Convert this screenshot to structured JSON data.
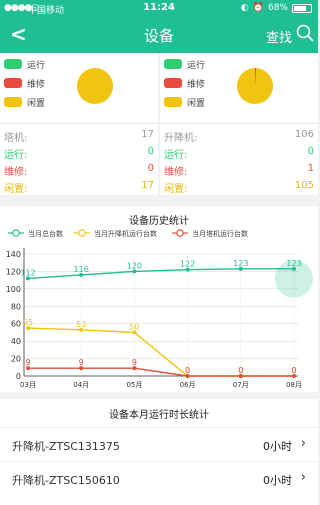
{
  "status": {
    "carrier": "中国移动",
    "time": "11:24",
    "battery": "68%"
  },
  "nav": {
    "title": "设备",
    "find_label": "查找"
  },
  "legend": [
    "运行",
    "维修",
    "闲置"
  ],
  "colors": {
    "green": "#2ecc71",
    "red": "#e74c3c",
    "yellow": "#f1c40f",
    "teal": "#1fbf93"
  },
  "tower": {
    "type_label": "塔机:",
    "total": "17",
    "running_label": "运行:",
    "running": "0",
    "repair_label": "维修:",
    "repair": "0",
    "idle_label": "闲置:",
    "idle": "17"
  },
  "lift": {
    "type_label": "升降机:",
    "total": "106",
    "running_label": "运行:",
    "running": "0",
    "repair_label": "维修:",
    "repair": "1",
    "idle_label": "闲置:",
    "idle": "105"
  },
  "history": {
    "title": "设备历史统计"
  },
  "chart_data": {
    "type": "line",
    "categories": [
      "03月",
      "04月",
      "05月",
      "06月",
      "07月",
      "08月"
    ],
    "ylim": [
      0,
      140
    ],
    "yticks": [
      0,
      20,
      40,
      60,
      80,
      100,
      120,
      140
    ],
    "grid": true,
    "legend_position": "top",
    "series": [
      {
        "name": "当月总台数",
        "color": "#1fbf93",
        "values": [
          112,
          116,
          120,
          122,
          123,
          123
        ]
      },
      {
        "name": "当月升降机运行台数",
        "color": "#f1c40f",
        "values": [
          55,
          53,
          50,
          0,
          0,
          0
        ]
      },
      {
        "name": "当月塔机运行台数",
        "color": "#e74c3c",
        "values": [
          9,
          9,
          9,
          0,
          0,
          0
        ]
      }
    ]
  },
  "duration": {
    "title": "设备本月运行时长统计",
    "rows": [
      {
        "name": "升降机-ZTSC131375",
        "value": "0小时"
      },
      {
        "name": "升降机-ZTSC150610",
        "value": "0小时"
      }
    ]
  }
}
